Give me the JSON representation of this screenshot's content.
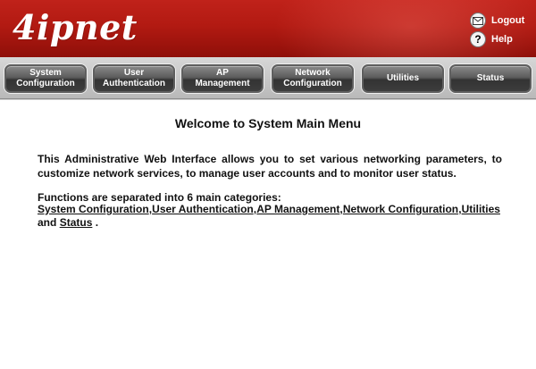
{
  "header": {
    "logo": "4ipnet",
    "logout_label": "Logout",
    "help_label": "Help",
    "help_glyph": "?"
  },
  "nav": {
    "tabs": [
      {
        "label": "System\nConfiguration"
      },
      {
        "label": "User\nAuthentication"
      },
      {
        "label": "AP\nManagement"
      },
      {
        "label": "Network\nConfiguration"
      },
      {
        "label": "Utilities"
      },
      {
        "label": "Status"
      }
    ]
  },
  "main": {
    "title": "Welcome to System Main Menu",
    "intro": "This Administrative Web Interface allows you to set various networking parameters, to customize network services, to manage user accounts and to monitor user status.",
    "categories_intro": "Functions are separated into 6 main categories:",
    "links": [
      "System Configuration",
      "User Authentication",
      "AP Management",
      "Network Configuration",
      "Utilities",
      "Status"
    ],
    "separator": ",",
    "and_text": "and",
    "end_punct": "."
  },
  "colors": {
    "header_red": "#b21a12",
    "tab_dark": "#3d3d3d",
    "nav_gray": "#c8c8c8"
  },
  "icons": [
    "envelope-icon",
    "help-icon"
  ]
}
